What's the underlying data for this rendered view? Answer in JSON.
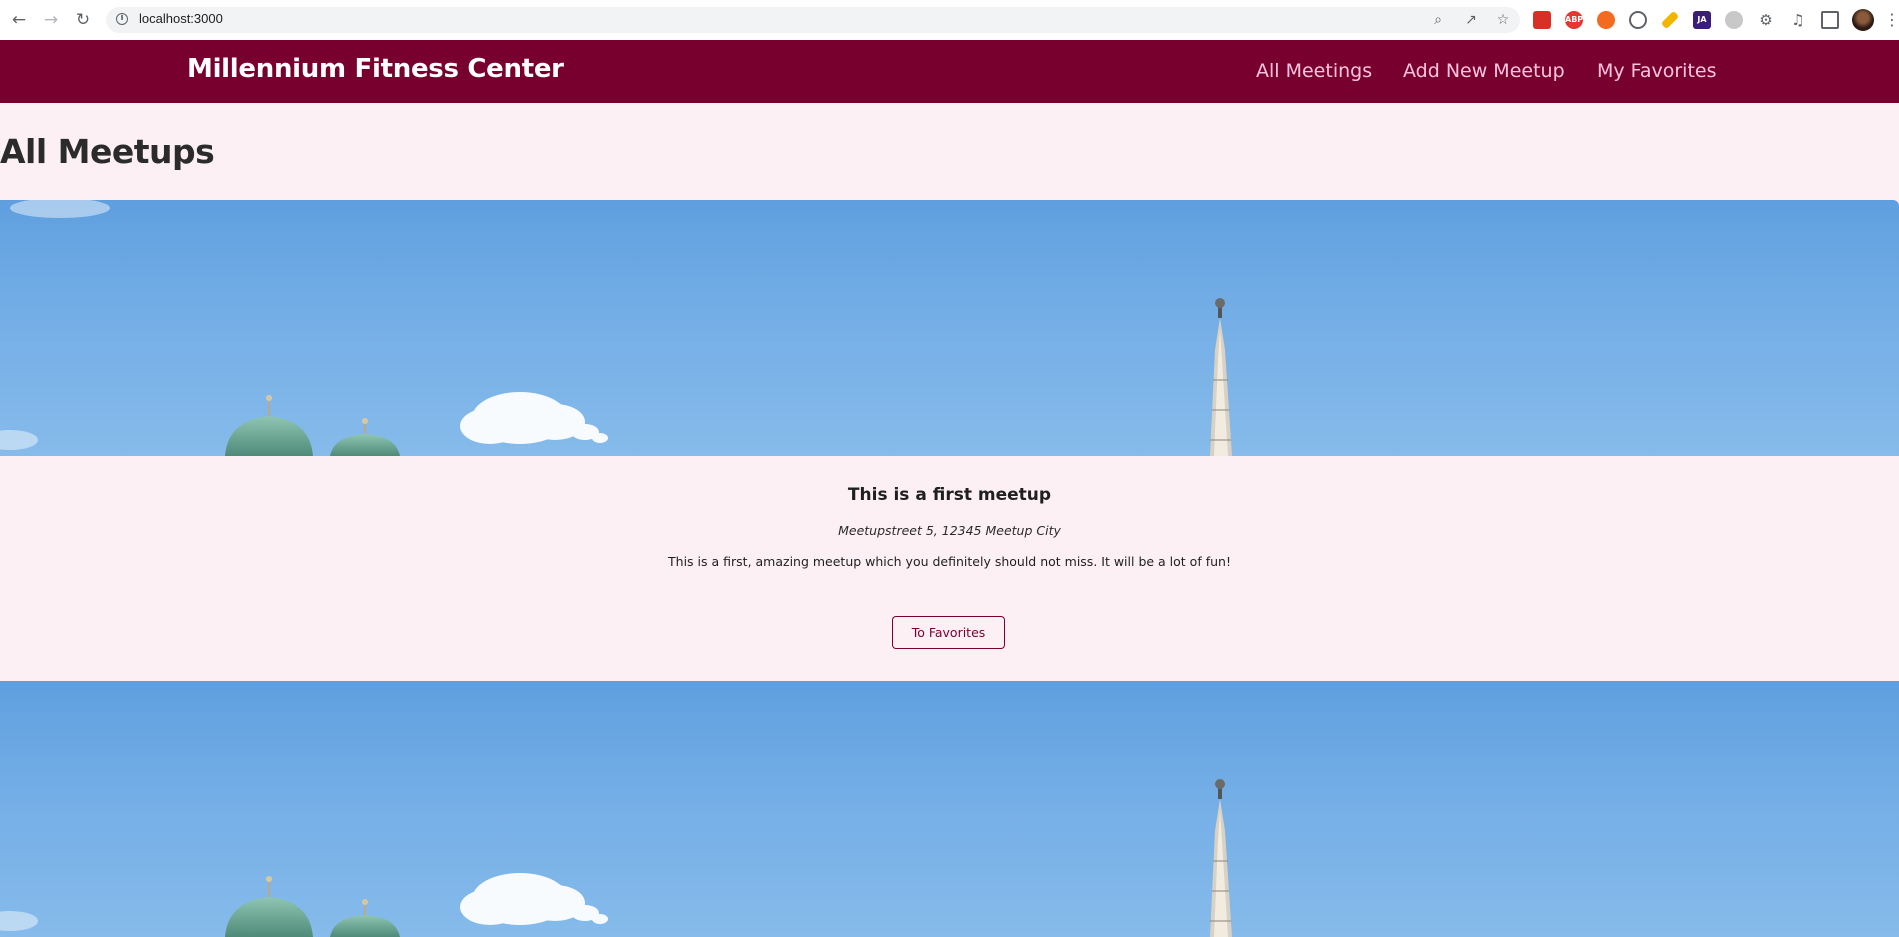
{
  "browser": {
    "url": "localhost:3000",
    "back_icon": "arrow-left-icon",
    "forward_icon": "arrow-right-icon",
    "reload_icon": "reload-icon",
    "extensions": [
      {
        "name": "extension-red-icon",
        "color": "#d93025",
        "label": ""
      },
      {
        "name": "adblock-icon",
        "color": "#e2382f",
        "label": "ABP"
      },
      {
        "name": "extension-orange-icon",
        "color": "#f26b21",
        "label": ""
      },
      {
        "name": "extension-circle-icon",
        "color": "#5f6368",
        "label": ""
      },
      {
        "name": "highlighter-icon",
        "color": "#f2b600",
        "label": ""
      },
      {
        "name": "extension-ja-icon",
        "color": "#3a1d7a",
        "label": "JA"
      },
      {
        "name": "extension-grey-icon",
        "color": "#c8c8c8",
        "label": ""
      }
    ]
  },
  "header": {
    "logo": "Millennium Fitness Center",
    "nav": [
      {
        "label": "All Meetings"
      },
      {
        "label": "Add New Meetup"
      },
      {
        "label": "My Favorites"
      }
    ],
    "colors": {
      "brand": "#77002e",
      "nav_link": "#fcc5dc"
    }
  },
  "main": {
    "title": "All Meetups",
    "meetups": [
      {
        "title": "This is a first meetup",
        "address": "Meetupstreet 5, 12345 Meetup City",
        "description": "This is a first, amazing meetup which you definitely should not miss. It will be a lot of fun!",
        "button_label": "To Favorites"
      },
      {
        "title": "",
        "address": "",
        "description": "",
        "button_label": ""
      }
    ]
  },
  "colors": {
    "page_background": "#fdf0f5",
    "sky": "#74aee6"
  }
}
